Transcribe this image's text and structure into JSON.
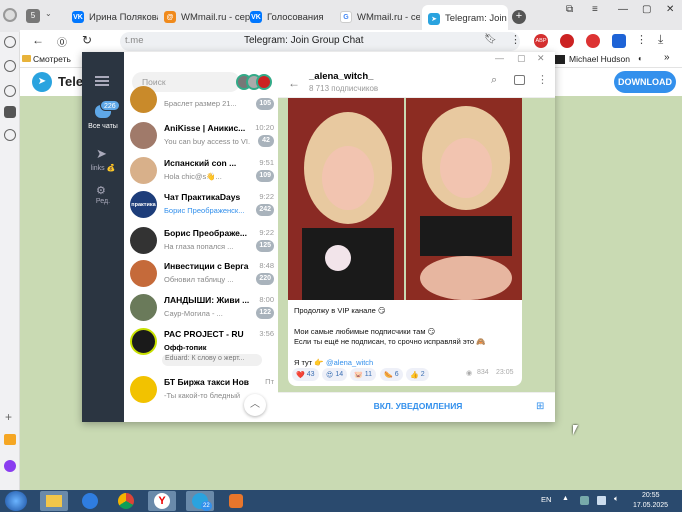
{
  "browser": {
    "tabs": [
      {
        "title": "Ирина Полякова",
        "favicon": "vk"
      },
      {
        "title": "WMmail.ru - серв",
        "favicon": "wm"
      },
      {
        "title": "Голосования",
        "favicon": "vk"
      },
      {
        "title": "WMmail.ru - серв",
        "favicon": "google"
      },
      {
        "title": "Telegram: Join",
        "favicon": "telegram"
      }
    ],
    "tab_counter": "5",
    "url_domain": "t.me",
    "page_title": "Telegram: Join Group Chat",
    "bookmarks_left": "Смотреть",
    "bookmarks_right": "Michael Hudson",
    "abp_label": "ABP"
  },
  "tg_web": {
    "brand": "Teleg",
    "download_label": "DOWNLOAD"
  },
  "tg_desktop": {
    "folders": [
      {
        "label": "Все чаты",
        "badge": "226"
      },
      {
        "label": "links 💰"
      },
      {
        "label": "Ред."
      }
    ],
    "search_placeholder": "Поиск",
    "chats": [
      {
        "name": "",
        "time": "",
        "msg": "Браслет размер 21...",
        "badge": "105",
        "color": "#c98a2a"
      },
      {
        "name": "AniKisse | Аникис...",
        "time": "10:20",
        "msg": "You can buy access to VI...",
        "badge": "42",
        "color": "#a07a6a"
      },
      {
        "name": "Испанский con ...",
        "time": "9:51",
        "msg": "Hola chic@s👋...",
        "badge": "109",
        "color": "#d8b08a"
      },
      {
        "name": "Чат ПрактикаDays",
        "time": "9:22",
        "msg": "Борис Преображенск...",
        "badge": "242",
        "color": "#1d3d7a",
        "avatar_text": "практика"
      },
      {
        "name": "Борис Преображе...",
        "time": "9:22",
        "msg": "На глаза попался ...",
        "badge": "125",
        "color": "#333"
      },
      {
        "name": "Инвестиции с Верга",
        "time": "8:48",
        "msg": "Обновил таблицу ...",
        "badge": "220",
        "color": "#c56a3a"
      },
      {
        "name": "ЛАНДЫШИ: Живи ...",
        "time": "8:00",
        "msg": "Саур-Могила - ...",
        "badge": "122",
        "color": "#6a7a5a"
      },
      {
        "name": "PAC PROJECT - RU",
        "time": "3:56",
        "msg": "Офф-топик",
        "msg2": "Eduard: К слову о жерт...",
        "badge": "",
        "color": "#1a1a1a"
      },
      {
        "name": "БТ Биржа такси Нов",
        "time": "Пт",
        "msg": "-Ты какой-то бледный",
        "badge": "",
        "color": "#f2c200"
      }
    ],
    "channel": {
      "name": "_alena_witch_",
      "subscribers": "8 713 подписчиков",
      "post_lines": [
        "Продолжу в VIP канале 😏",
        "Мои самые любимые подписчики там 😏",
        "Если ты ещё не подписан, то срочно исправляй это 🙈",
        "Я тут 👉"
      ],
      "post_link": "@alena_witch",
      "reactions": [
        {
          "emoji": "❤️",
          "count": "43"
        },
        {
          "emoji": "😍",
          "count": "14"
        },
        {
          "emoji": "🐷",
          "count": "11"
        },
        {
          "emoji": "🌭",
          "count": "6"
        },
        {
          "emoji": "👍",
          "count": "2"
        }
      ],
      "views": "834",
      "time": "23:05",
      "notify_label": "ВКЛ. УВЕДОМЛЕНИЯ"
    }
  },
  "taskbar": {
    "lang": "EN",
    "time": "20:55",
    "date": "17.05.2025",
    "telegram_badge": "22"
  }
}
